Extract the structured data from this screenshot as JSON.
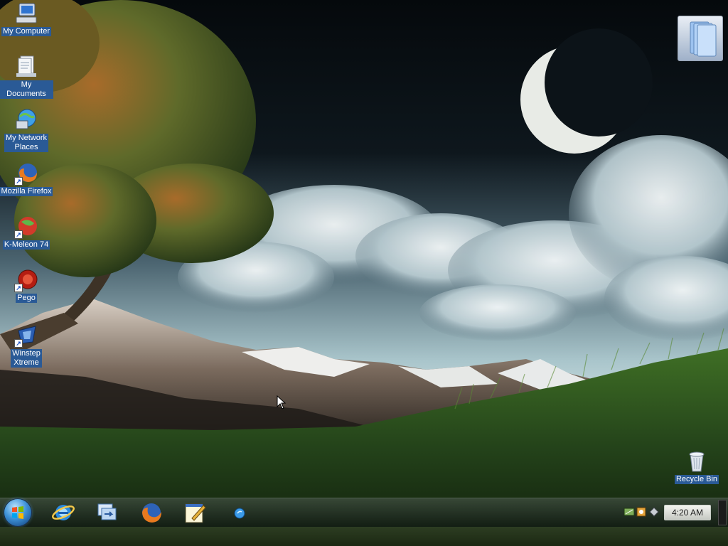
{
  "desktop": {
    "icons": [
      {
        "label": "My Computer",
        "icon": "computer-icon"
      },
      {
        "label": "My Documents",
        "icon": "documents-icon"
      },
      {
        "label": "My Network\nPlaces",
        "icon": "network-icon"
      },
      {
        "label": "Mozilla Firefox",
        "icon": "firefox-icon"
      },
      {
        "label": "K-Meleon 74",
        "icon": "kmeleon-icon"
      },
      {
        "label": "Pego",
        "icon": "pego-icon"
      },
      {
        "label": "Winstep\nXtreme",
        "icon": "winstep-icon"
      },
      {
        "label": "Recycle Bin",
        "icon": "recycle-bin-icon"
      }
    ]
  },
  "taskbar": {
    "start": {
      "icon": "windows-orb-icon"
    },
    "quick_launch": [
      {
        "icon": "internet-explorer-icon"
      },
      {
        "icon": "switch-windows-icon"
      },
      {
        "icon": "firefox-icon"
      },
      {
        "icon": "notepad-icon"
      },
      {
        "icon": "media-icon"
      }
    ],
    "tray_icons": [
      "network-tray-icon",
      "volume-tray-icon",
      "connection-tray-icon"
    ],
    "clock": "4:20 AM"
  },
  "colors": {
    "icon_label_bg": "#2a5a96",
    "sky_top": "#05090c",
    "grass": "#2f5a1e"
  }
}
